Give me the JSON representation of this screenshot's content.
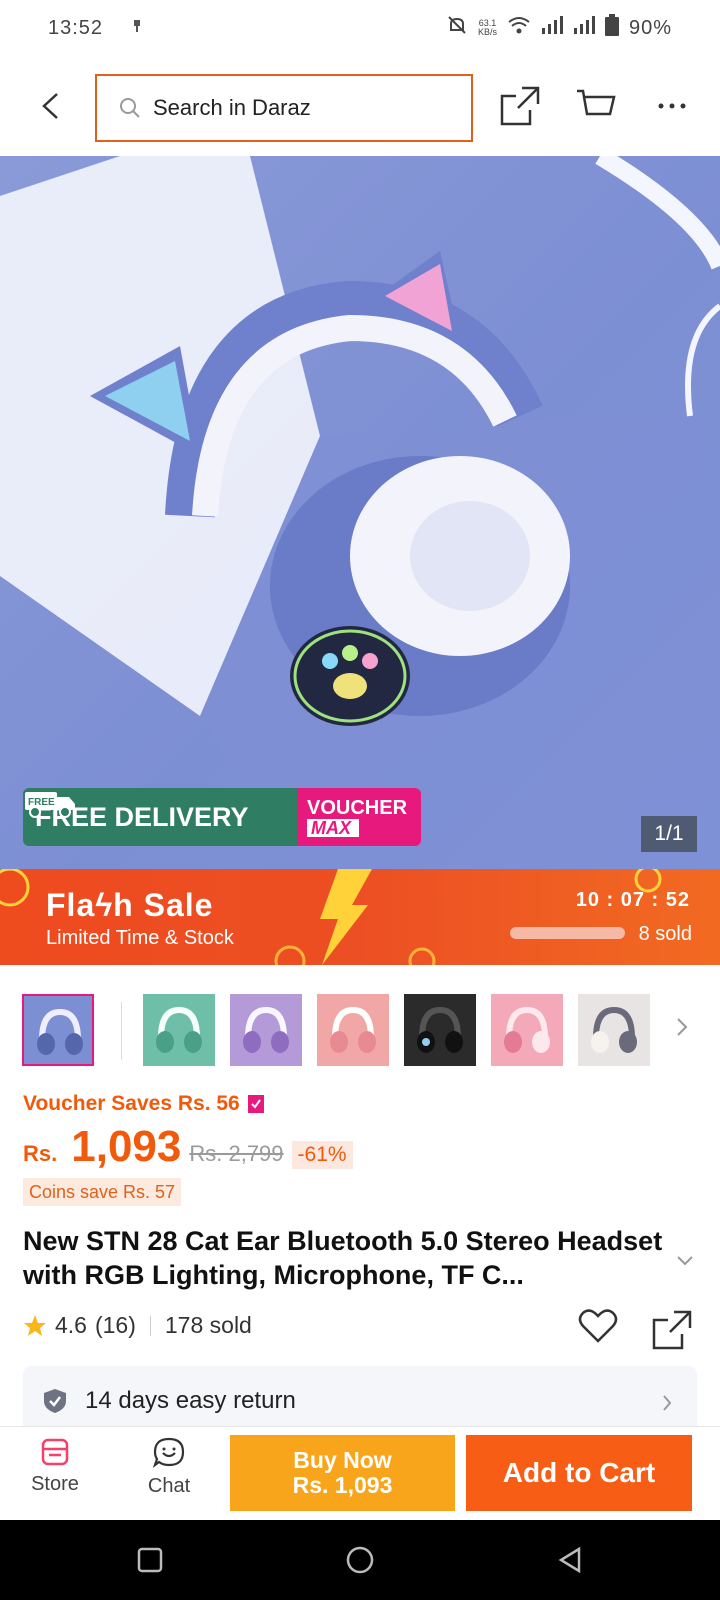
{
  "status_bar": {
    "time": "13:52",
    "net_speed_value": "63.1",
    "net_speed_unit": "KB/s",
    "battery": "90%"
  },
  "header": {
    "search_placeholder": "Search in Daraz"
  },
  "gallery": {
    "counter": "1/1",
    "promo_free": "FREE DELIVERY",
    "promo_free_tag": "FREE",
    "promo_voucher_line1": "VOUCHER",
    "promo_voucher_line2": "MAX",
    "thumbnail_colors": [
      "#7d8fd3",
      "#6fbfa8",
      "#b59ad8",
      "#f2a7a7",
      "#2b2b2b",
      "#f3a9b8",
      "#e8e4e4"
    ]
  },
  "flash_sale": {
    "title": "Flaϟh Sale",
    "subtitle": "Limited Time & Stock",
    "timer": "10 : 07 : 52",
    "sold": "8 sold",
    "sold_progress": 1.0
  },
  "pricing": {
    "voucher_saves": "Voucher Saves Rs. 56",
    "currency": "Rs.",
    "price": "1,093",
    "original_price": "Rs. 2,799",
    "discount": "-61%",
    "coins_save": "Coins save Rs. 57"
  },
  "product": {
    "title": "New STN 28 Cat Ear Bluetooth 5.0 Stereo Headset with RGB Lighting, Microphone, TF C...",
    "rating": "4.6",
    "reviews": "(16)",
    "sold": "178 sold"
  },
  "services": {
    "return_policy": "14 days easy return"
  },
  "action_bar": {
    "store_label": "Store",
    "chat_label": "Chat",
    "buy_now_line1": "Buy Now",
    "buy_now_line2": "Rs. 1,093",
    "add_to_cart": "Add to Cart"
  },
  "colors": {
    "accent": "#f15a0b",
    "buy_now": "#f8a51c",
    "add_to_cart": "#f75d15",
    "search_border": "#e0611c"
  }
}
